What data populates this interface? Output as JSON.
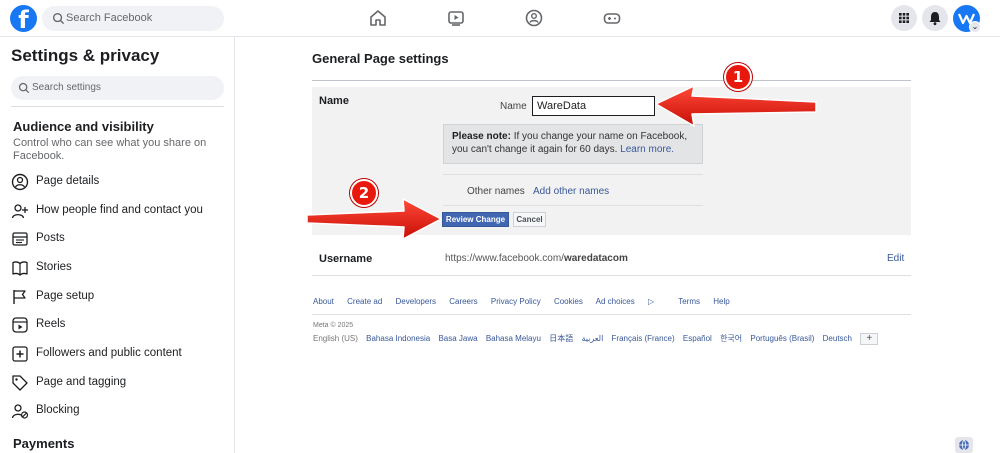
{
  "header": {
    "logo": "f",
    "search_placeholder": "Search Facebook",
    "nav_icons": [
      "home-icon",
      "watch-icon",
      "groups-icon",
      "gaming-icon"
    ],
    "right_icons": [
      "menu-grid-icon",
      "notifications-icon",
      "account-avatar"
    ]
  },
  "sidebar": {
    "title": "Settings & privacy",
    "search_placeholder": "Search settings",
    "section1": {
      "title": "Audience and visibility",
      "description": "Control who can see what you share on Facebook."
    },
    "items": [
      {
        "label": "Page details",
        "icon": "person-circle-icon"
      },
      {
        "label": "How people find and contact you",
        "icon": "person-add-icon"
      },
      {
        "label": "Posts",
        "icon": "posts-icon"
      },
      {
        "label": "Stories",
        "icon": "book-icon"
      },
      {
        "label": "Page setup",
        "icon": "flag-icon"
      },
      {
        "label": "Reels",
        "icon": "reels-icon"
      },
      {
        "label": "Followers and public content",
        "icon": "plus-square-icon"
      },
      {
        "label": "Page and tagging",
        "icon": "tag-icon"
      },
      {
        "label": "Blocking",
        "icon": "person-block-icon"
      }
    ],
    "section2": {
      "title": "Payments"
    }
  },
  "main": {
    "title": "General Page settings",
    "name_section": {
      "label": "Name",
      "field_label": "Name",
      "field_value": "WareData",
      "note_bold": "Please note:",
      "note_text": " If you change your name on Facebook, you can't change it again for 60 days. ",
      "note_link": "Learn more.",
      "other_names_label": "Other names",
      "other_names_link": "Add other names",
      "review_button": "Review Change",
      "cancel_button": "Cancel"
    },
    "username": {
      "label": "Username",
      "url_prefix": "https://www.facebook.com/",
      "url_handle": "waredatacom",
      "edit": "Edit"
    }
  },
  "footer": {
    "links": [
      "About",
      "Create ad",
      "Developers",
      "Careers",
      "Privacy Policy",
      "Cookies",
      "Ad choices",
      "Terms",
      "Help"
    ],
    "copyright": "Meta © 2025",
    "current_language": "English (US)",
    "languages": [
      "Bahasa Indonesia",
      "Basa Jawa",
      "Bahasa Melayu",
      "日本語",
      "العربية",
      "Français (France)",
      "Español",
      "한국어",
      "Português (Brasil)",
      "Deutsch"
    ],
    "more_button": "+"
  },
  "annotations": {
    "marker1": "1",
    "marker2": "2",
    "color": "#e8180c"
  }
}
